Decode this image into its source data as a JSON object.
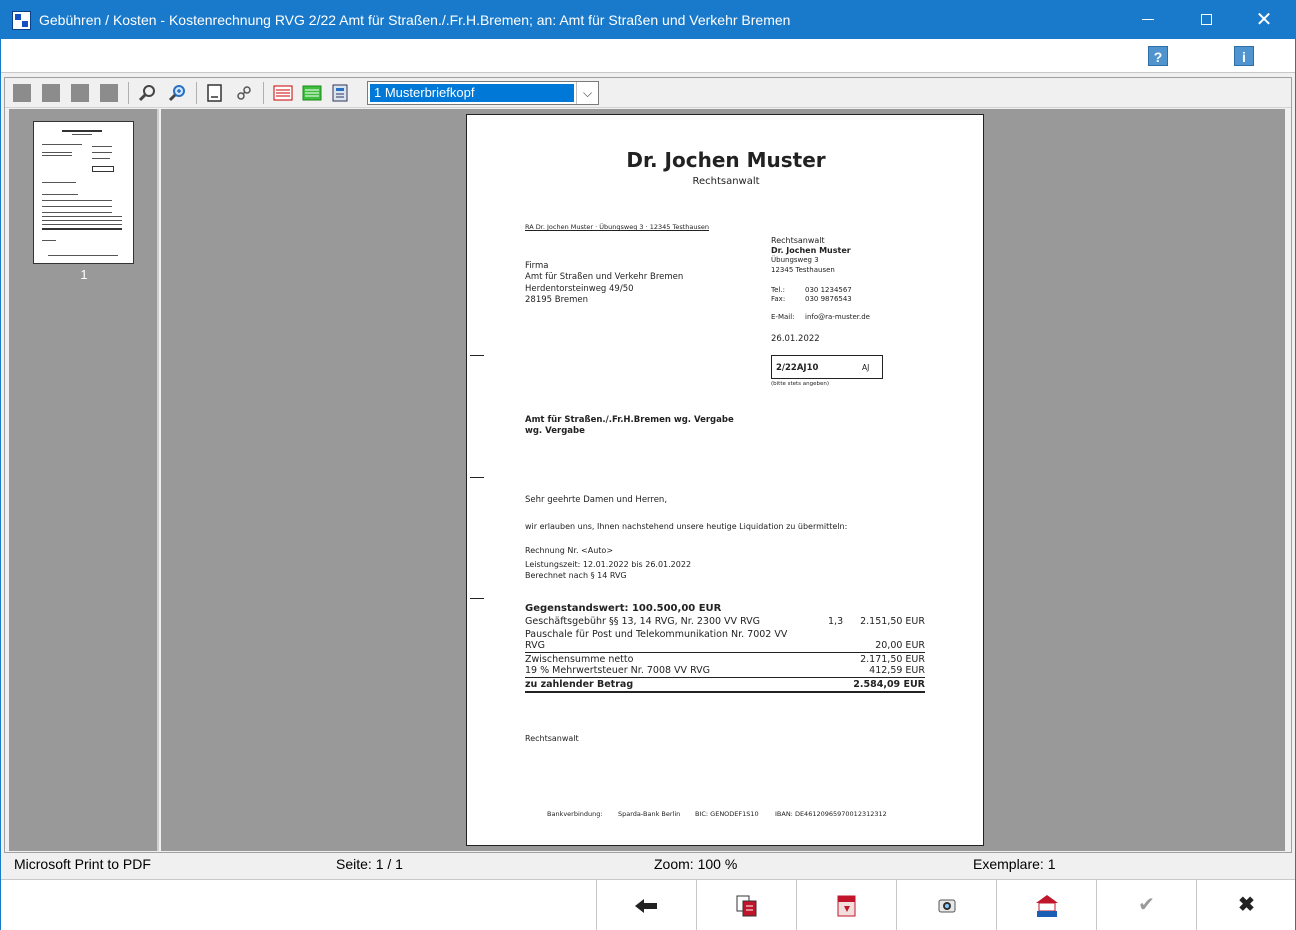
{
  "window": {
    "title": "Gebühren / Kosten - Kostenrechnung RVG 2/22 Amt für Straßen./.Fr.H.Bremen; an: Amt für Straßen und Verkehr Bremen",
    "buttons": {
      "minimize": "minimize-icon",
      "maximize": "maximize-icon",
      "close": "close-icon"
    }
  },
  "helpbar": {
    "help": "?",
    "info": "i"
  },
  "toolbar": {
    "icons": [
      "first-page-icon",
      "prev-page-icon",
      "next-page-icon",
      "last-page-icon",
      "zoom-out-icon",
      "zoom-in-icon",
      "page-setup-icon",
      "printer-setup-icon",
      "letterhead-red-icon",
      "letterhead-green-icon",
      "letterhead-manage-icon"
    ],
    "letterhead": {
      "selected": "1    Musterbriefkopf"
    }
  },
  "thumbnails": {
    "pages": [
      {
        "number": "1"
      }
    ]
  },
  "document": {
    "name": "Dr. Jochen Muster",
    "subtitle": "Rechtsanwalt",
    "sender_line": "RA Dr. Jochen Muster · Übungsweg 3 · 12345 Testhausen",
    "recipient": {
      "line1": "Firma",
      "line2": "Amt für Straßen und Verkehr Bremen",
      "line3": "Herdentorsteinweg 49/50",
      "line4": "28195 Bremen"
    },
    "sender_block": {
      "role": "Rechtsanwalt",
      "name": "Dr. Jochen Muster",
      "street": "Übungsweg 3",
      "city": "12345 Testhausen",
      "tel_label": "Tel.:",
      "tel": "030 1234567",
      "fax_label": "Fax:",
      "fax": "030 9876543",
      "email_label": "E-Mail:",
      "email": "info@ra-muster.de",
      "date": "26.01.2022"
    },
    "reference": {
      "file_no": "2/22AJ10",
      "initials": "AJ",
      "note": "(bitte stets angeben)"
    },
    "subject": {
      "line1": "Amt für Straßen./.Fr.H.Bremen wg. Vergabe",
      "line2": "wg. Vergabe"
    },
    "salutation": "Sehr geehrte Damen und Herren,",
    "intro": "wir erlauben uns, Ihnen nachstehend unsere heutige Liquidation zu übermitteln:",
    "invoice_no": "Rechnung Nr. <Auto>",
    "period": "Leistungszeit: 12.01.2022 bis 26.01.2022",
    "basis": "Berechnet nach § 14 RVG",
    "value_line": "Gegenstandswert: 100.500,00 EUR",
    "items": [
      {
        "desc": "Geschäftsgebühr §§ 13, 14 RVG, Nr. 2300 VV RVG",
        "factor": "1,3",
        "amount": "2.151,50 EUR"
      },
      {
        "desc": "Pauschale für Post und Telekommunikation Nr. 7002 VV",
        "desc2": "RVG",
        "amount": "20,00 EUR"
      }
    ],
    "subtotal": {
      "label": "Zwischensumme netto",
      "amount": "2.171,50 EUR"
    },
    "vat": {
      "label": "19 % Mehrwertsteuer Nr. 7008 VV RVG",
      "amount": "412,59 EUR"
    },
    "total": {
      "label": "zu zahlender Betrag",
      "amount": "2.584,09 EUR"
    },
    "signature": "Rechtsanwalt",
    "footer": {
      "bank_label": "Bankverbindung:",
      "bank": "Sparda-Bank Berlin",
      "bic": "BIC: GENODEF1S10",
      "iban": "IBAN: DE46120965970012312312"
    }
  },
  "status": {
    "printer": "Microsoft Print to PDF",
    "page": "Seite: 1 / 1",
    "zoom": "Zoom: 100 %",
    "copies": "Exemplare: 1"
  },
  "bottom_buttons": [
    "back-arrow-icon",
    "copy-document-icon",
    "pdf-icon",
    "scan-icon",
    "bea-icon",
    "confirm-icon",
    "cancel-icon"
  ],
  "colors": {
    "titlebar": "#1979ca",
    "selection": "#0078d7",
    "preview_bg": "#999999"
  }
}
